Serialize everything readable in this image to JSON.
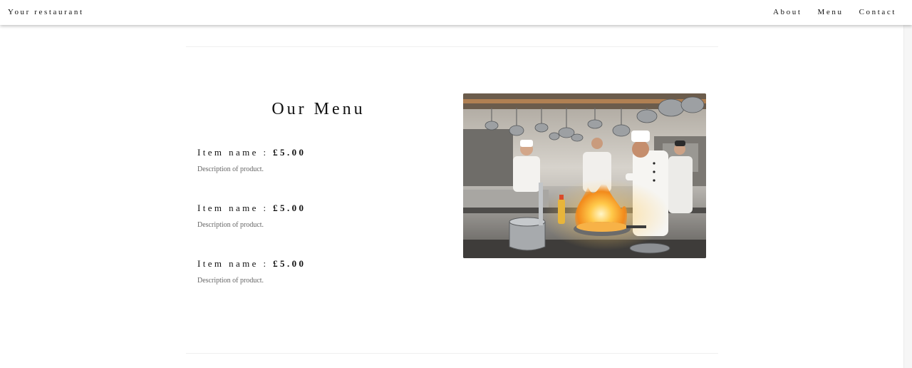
{
  "header": {
    "brand": "Your restaurant",
    "nav": [
      {
        "label": "About"
      },
      {
        "label": "Menu"
      },
      {
        "label": "Contact"
      }
    ]
  },
  "menu": {
    "title": "Our Menu",
    "items": [
      {
        "name": "Item name",
        "separator": ":",
        "price": "£5.00",
        "description": "Description of product."
      },
      {
        "name": "Item name",
        "separator": ":",
        "price": "£5.00",
        "description": "Description of product."
      },
      {
        "name": "Item name",
        "separator": ":",
        "price": "£5.00",
        "description": "Description of product."
      }
    ]
  },
  "image": {
    "subject": "chefs cooking in a restaurant kitchen with flames",
    "colors": {
      "steel": "#8c8f93",
      "flame": "#ffb43c",
      "wall": "#c9c6c0"
    }
  }
}
